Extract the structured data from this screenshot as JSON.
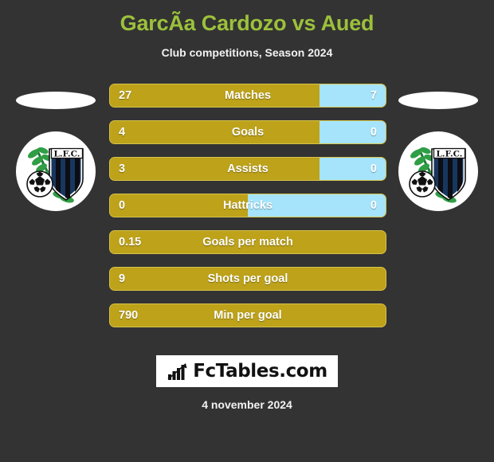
{
  "header": {
    "title": "GarcÃ­a Cardozo vs Aued",
    "subtitle": "Club competitions, Season 2024"
  },
  "colors": {
    "background": "#333333",
    "title": "#9cc13b",
    "home_bar": "#bda21a",
    "away_bar": "#a5e4fb",
    "text": "#ffffff"
  },
  "crests": {
    "left": {
      "name": "club-crest-left",
      "badge_text": "L.F.C."
    },
    "right": {
      "name": "club-crest-right",
      "badge_text": "L.F.C."
    }
  },
  "stats": [
    {
      "label": "Matches",
      "home": "27",
      "away": "7",
      "home_pct": 76,
      "two_sided": true
    },
    {
      "label": "Goals",
      "home": "4",
      "away": "0",
      "home_pct": 76,
      "two_sided": true
    },
    {
      "label": "Assists",
      "home": "3",
      "away": "0",
      "home_pct": 76,
      "two_sided": true
    },
    {
      "label": "Hattricks",
      "home": "0",
      "away": "0",
      "home_pct": 50,
      "two_sided": true
    },
    {
      "label": "Goals per match",
      "home": "0.15",
      "away": "",
      "home_pct": 100,
      "two_sided": false
    },
    {
      "label": "Shots per goal",
      "home": "9",
      "away": "",
      "home_pct": 100,
      "two_sided": false
    },
    {
      "label": "Min per goal",
      "home": "790",
      "away": "",
      "home_pct": 100,
      "two_sided": false
    }
  ],
  "footer": {
    "logo_text": "FcTables.com",
    "logo_icon": "bar-chart-icon",
    "date": "4 november 2024"
  }
}
